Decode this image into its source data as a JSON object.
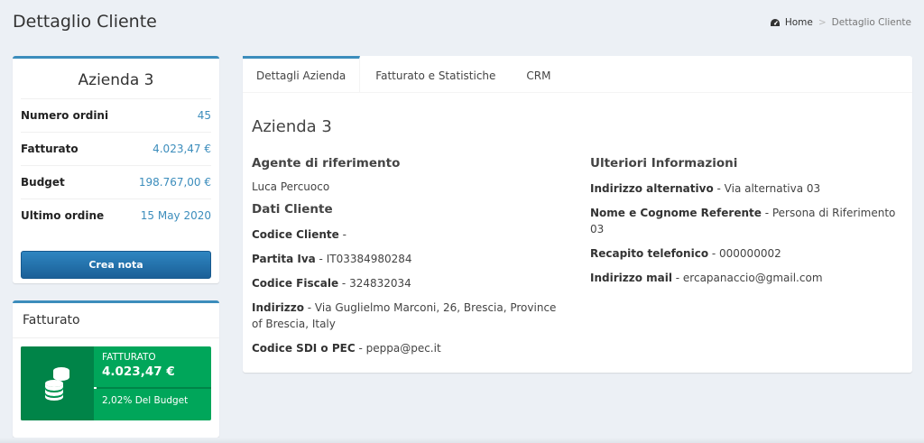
{
  "page": {
    "title": "Dettaglio Cliente",
    "breadcrumb": {
      "home": "Home",
      "current": "Dettaglio Cliente"
    }
  },
  "profile": {
    "name": "Azienda 3",
    "stats": [
      {
        "label": "Numero ordini",
        "value": "45"
      },
      {
        "label": "Fatturato",
        "value": "4.023,47 €"
      },
      {
        "label": "Budget",
        "value": "198.767,00 €"
      },
      {
        "label": "Ultimo ordine",
        "value": "15 May 2020"
      }
    ],
    "button_label": "Crea nota",
    "accent_color": "#3c8dbc"
  },
  "fatturato": {
    "title": "Fatturato",
    "info_label": "FATTURATO",
    "info_value": "4.023,47 €",
    "progress_percent": 2.02,
    "description": "2,02% Del Budget",
    "icon": "coins-icon",
    "color": "#00a65a"
  },
  "tabs": [
    {
      "label": "Dettagli Azienda",
      "active": true
    },
    {
      "label": "Fatturato e Statistiche",
      "active": false
    },
    {
      "label": "CRM",
      "active": false
    }
  ],
  "details": {
    "company_name": "Azienda 3",
    "agent_heading": "Agente di riferimento",
    "agent_name": "Luca Percuoco",
    "client_heading": "Dati Cliente",
    "client_fields": [
      {
        "label": "Codice Cliente",
        "value": " -"
      },
      {
        "label": "Partita Iva",
        "value": " - IT03384980284"
      },
      {
        "label": "Codice Fiscale",
        "value": " - 324832034"
      },
      {
        "label": "Indirizzo",
        "value": " - Via Guglielmo Marconi, 26, Brescia, Province of Brescia, Italy"
      },
      {
        "label": "Codice SDI o PEC",
        "value": " - peppa@pec.it"
      }
    ],
    "extra_heading": "Ulteriori Informazioni",
    "extra_fields": [
      {
        "label": "Indirizzo alternativo",
        "value": " - Via alternativa 03"
      },
      {
        "label": "Nome e Cognome Referente",
        "value": " - Persona di Riferimento 03"
      },
      {
        "label": "Recapito telefonico",
        "value": " - 000000002"
      },
      {
        "label": "Indirizzo mail",
        "value": " - ercapanaccio@gmail.com"
      }
    ]
  }
}
